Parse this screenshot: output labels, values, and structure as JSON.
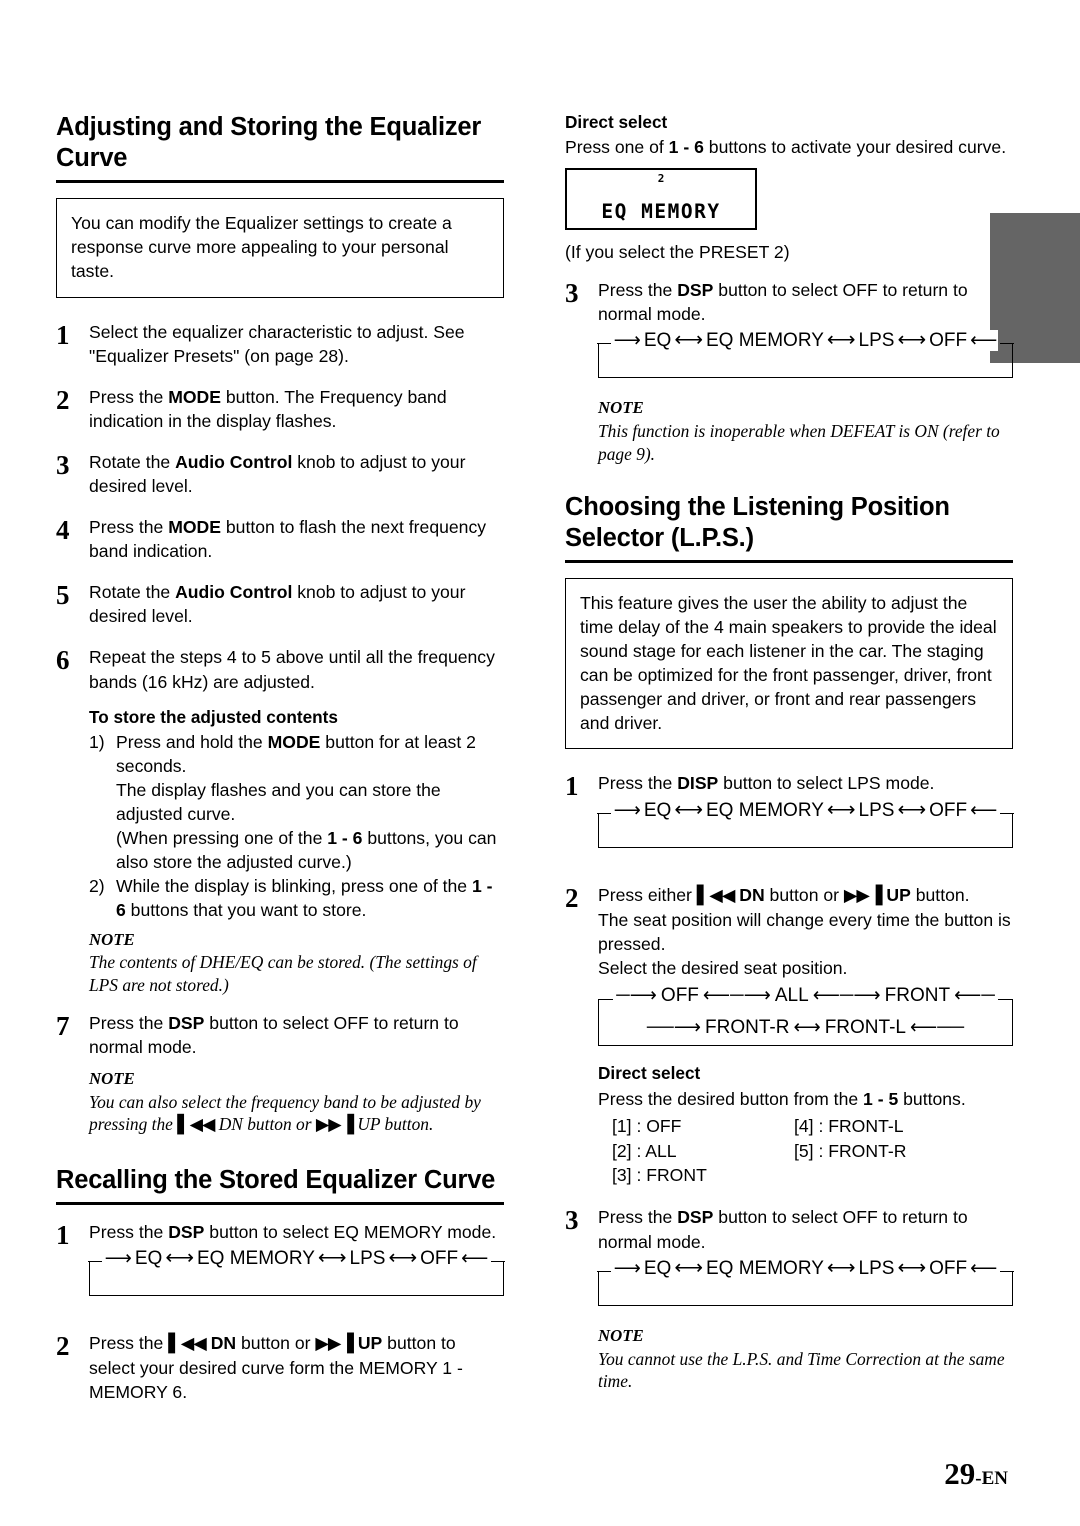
{
  "page": {
    "number": "29",
    "suffix": "-EN"
  },
  "left_column": {
    "heading1": "Adjusting and Storing the Equalizer Curve",
    "intro": "You can modify the Equalizer settings to create a response curve more appealing to your personal taste.",
    "steps": [
      {
        "num": "1",
        "text": "Select the equalizer characteristic to adjust. See \"Equalizer Presets\" (on page 28)."
      },
      {
        "num": "2",
        "text_pre": "Press the ",
        "bold": "MODE",
        "text_post": " button. The Frequency band indication in the display flashes."
      },
      {
        "num": "3",
        "text_pre": "Rotate the ",
        "bold": "Audio Control",
        "text_post": " knob to adjust to your desired level."
      },
      {
        "num": "4",
        "text_pre": "Press the ",
        "bold": "MODE",
        "text_post": " button to flash the next frequency band indication."
      },
      {
        "num": "5",
        "text_pre": "Rotate the ",
        "bold": "Audio Control",
        "text_post": " knob to adjust to your desired level."
      },
      {
        "num": "6",
        "text": "Repeat the steps 4 to 5 above until all the frequency bands (16 kHz) are adjusted."
      }
    ],
    "store_head": "To store the adjusted contents",
    "store_items": [
      {
        "mark": "1)",
        "pre": "Press and hold the ",
        "bold": "MODE",
        "post": " button for at least 2 seconds."
      },
      {
        "mark": "",
        "line": "The display flashes and you can store the adjusted curve."
      },
      {
        "mark": "",
        "pre2": "(When pressing one of the ",
        "bold2": "1 - 6",
        "post2": " buttons, you can also store the adjusted curve.)"
      },
      {
        "mark": "2)",
        "pre3": "While the display is blinking, press one of the ",
        "bold3": "1 - 6",
        "post3": " buttons that you want to store."
      }
    ],
    "note1_label": "NOTE",
    "note1_text": "The contents of DHE/EQ can be stored. (The settings of LPS are not stored.)",
    "step7": {
      "num": "7",
      "pre": "Press the ",
      "bold": "DSP",
      "post": " button to select OFF to return to normal mode."
    },
    "note2_label": "NOTE",
    "note2_a": "You can also select the frequency band to be adjusted by pressing the ",
    "note2_dn": "DN button or ",
    "note2_up": "UP button.",
    "heading2": "Recalling the Stored Equalizer Curve",
    "recall_step1": {
      "num": "1",
      "pre": "Press the ",
      "bold": "DSP",
      "post": " button to select EQ MEMORY mode."
    },
    "recall_step2": {
      "num": "2",
      "pre": "Press the ",
      "bold_dn": "DN",
      "mid": " button or ",
      "bold_up": "UP",
      "post": " button to select your desired curve form the MEMORY 1 - MEMORY 6."
    }
  },
  "right_column": {
    "direct_select_head": "Direct select",
    "direct_select_pre": "Press one of ",
    "direct_select_bold": "1 - 6",
    "direct_select_post": " buttons to activate your desired curve.",
    "lcd": {
      "top": "2",
      "main": "EQ MEMORY"
    },
    "lcd_caption": "(If you select the PRESET 2)",
    "step3": {
      "num": "3",
      "pre": "Press the ",
      "bold": "DSP",
      "post": " button to select OFF to return to normal mode."
    },
    "note1_label": "NOTE",
    "note1_text": "This function is inoperable when DEFEAT is ON (refer to page 9).",
    "heading": "Choosing the Listening Position Selector (L.P.S.)",
    "intro": "This feature gives the user the ability to adjust the time delay of the 4 main speakers to provide the ideal sound stage for each listener in the car. The staging can be optimized for the front passenger, driver, front passenger and driver, or front and rear passengers and driver.",
    "lps_step1": {
      "num": "1",
      "pre": "Press the ",
      "bold": "DISP",
      "post": " button to select LPS mode."
    },
    "lps_step2": {
      "num": "2",
      "pre": "Press either ",
      "bold_dn": "DN",
      "mid": " button or ",
      "bold_up": "UP",
      "post": " button.",
      "line2": "The seat position will change every time the button is pressed.",
      "line3": "Select the desired seat position."
    },
    "direct_select2_head": "Direct select",
    "direct_select2_pre": "Press the desired button from the ",
    "direct_select2_bold": "1 - 5",
    "direct_select2_post": " buttons.",
    "ds_rows": [
      {
        "left": "[1] : OFF",
        "right": "[4] : FRONT-L"
      },
      {
        "left": "[2] : ALL",
        "right": "[5] : FRONT-R"
      },
      {
        "left": "[3] : FRONT",
        "right": ""
      }
    ],
    "lps_step3": {
      "num": "3",
      "pre": "Press the ",
      "bold": "DSP",
      "post": " button to select OFF to return to normal mode."
    },
    "note2_label": "NOTE",
    "note2_text": "You cannot use the L.P.S. and Time Correction at the same time."
  },
  "flow_dsp": {
    "items": [
      "EQ",
      "EQ MEMORY",
      "LPS",
      "OFF"
    ]
  },
  "flow_seat": {
    "row_a": [
      "OFF",
      "ALL",
      "FRONT"
    ],
    "row_b": [
      "FRONT-R",
      "FRONT-L"
    ]
  },
  "icons": {
    "prev_track": "prev-track-icon",
    "next_track": "next-track-icon"
  }
}
